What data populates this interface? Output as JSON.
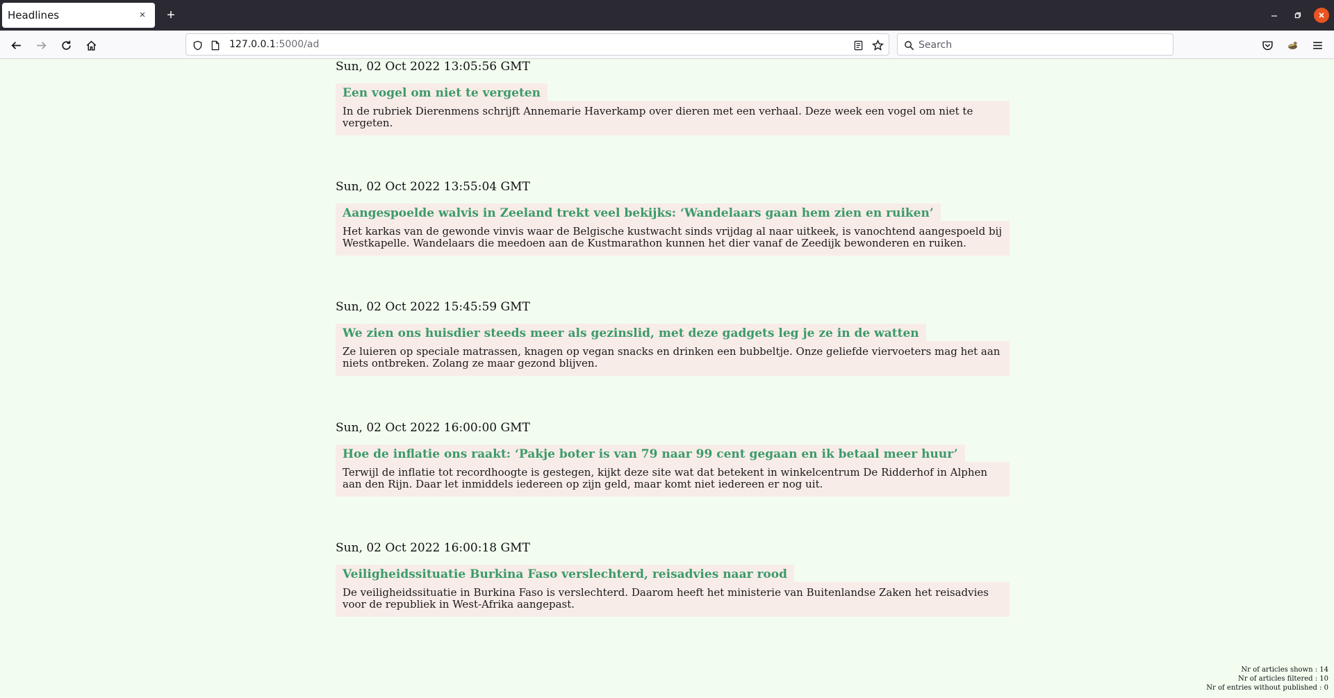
{
  "browser": {
    "tab_title": "Headlines",
    "tab_close_icon": "×",
    "new_tab_icon": "+",
    "url_host": "127.0.0.1",
    "url_rest": ":5000/ad",
    "search_placeholder": "Search"
  },
  "articles": [
    {
      "date": "Sun, 02 Oct 2022 13:05:56 GMT",
      "title": "Een vogel om niet te vergeten",
      "summary": "In de rubriek Dierenmens schrijft Annemarie Haverkamp over dieren met een verhaal. Deze week een vogel om niet te vergeten."
    },
    {
      "date": "Sun, 02 Oct 2022 13:55:04 GMT",
      "title": "Aangespoelde walvis in Zeeland trekt veel bekijks: ‘Wandelaars gaan hem zien en ruiken’",
      "summary": "Het karkas van de gewonde vinvis waar de Belgische kustwacht sinds vrijdag al naar uitkeek, is vanochtend aangespoeld bij Westkapelle. Wandelaars die meedoen aan de Kustmarathon kunnen het dier vanaf de Zeedijk bewonderen en ruiken."
    },
    {
      "date": "Sun, 02 Oct 2022 15:45:59 GMT",
      "title": "We zien ons huisdier steeds meer als gezinslid, met deze gadgets leg je ze in de watten",
      "summary": "Ze luieren op speciale matrassen, knagen op vegan snacks en drinken een bubbeltje. Onze geliefde viervoeters mag het aan niets ontbreken. Zolang ze maar gezond blijven."
    },
    {
      "date": "Sun, 02 Oct 2022 16:00:00 GMT",
      "title": "Hoe de inflatie ons raakt: ‘Pakje boter is van 79 naar 99 cent gegaan en ik betaal meer huur’",
      "summary": "Terwijl de inflatie tot recordhoogte is gestegen, kijkt deze site wat dat betekent in winkelcentrum De Ridderhof in Alphen aan den Rijn. Daar let inmiddels iedereen op zijn geld, maar komt niet iedereen er nog uit."
    },
    {
      "date": "Sun, 02 Oct 2022 16:00:18 GMT",
      "title": "Veiligheidssituatie Burkina Faso verslechterd, reisadvies naar rood",
      "summary": "De veiligheidssituatie in Burkina Faso is verslechterd. Daarom heeft het ministerie van Buitenlandse Zaken het reisadvies voor de republiek in West-Afrika aangepast."
    }
  ],
  "stats": {
    "shown": "Nr of articles shown : 14",
    "filtered": "Nr of articles filtered : 10",
    "without_published": "Nr of entries without published : 0"
  },
  "colors": {
    "page_bg": "#f2fdf0",
    "card_bg": "#f8ece8",
    "title_green": "#3a9b6a",
    "close_orange": "#e95420"
  }
}
